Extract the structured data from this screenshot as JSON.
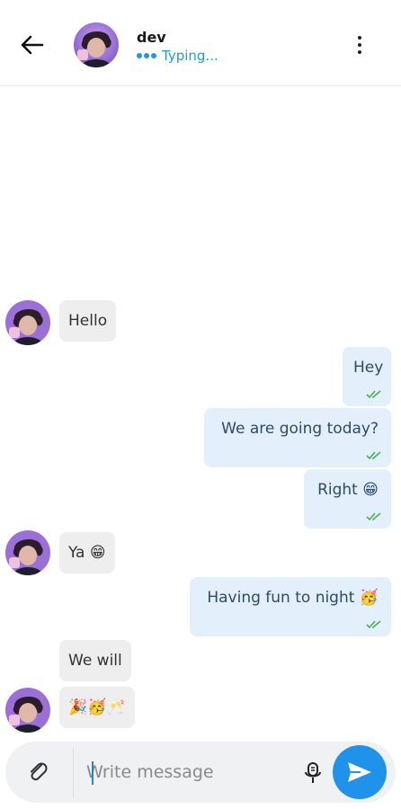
{
  "header": {
    "contact_name": "dev",
    "status": "Typing..."
  },
  "messages": [
    {
      "direction": "incoming",
      "text": "Hello"
    },
    {
      "direction": "outgoing",
      "text": "Hey",
      "status": "read"
    },
    {
      "direction": "outgoing",
      "text": "We are going today?",
      "status": "read"
    },
    {
      "direction": "outgoing",
      "text": "Right",
      "emoji": "😁",
      "status": "read"
    },
    {
      "direction": "incoming",
      "text": "Ya",
      "emoji": "😁"
    },
    {
      "direction": "outgoing",
      "text": "Having fun to night",
      "emoji": "🥳",
      "status": "read"
    },
    {
      "direction": "incoming",
      "text": "We will"
    },
    {
      "direction": "incoming",
      "text": "🎉🥳🥂"
    }
  ],
  "composer": {
    "placeholder": "Write message",
    "value": ""
  },
  "colors": {
    "accent": "#1f93ea",
    "outgoing_bubble": "#e3f0fb",
    "incoming_bubble": "#eeeeee",
    "read_ticks": "#4caf50"
  },
  "icons": {
    "back": "arrow-left-icon",
    "menu": "more-vertical-icon",
    "attach": "paperclip-icon",
    "mic": "microphone-icon",
    "send": "send-icon",
    "ticks": "double-check-icon"
  }
}
